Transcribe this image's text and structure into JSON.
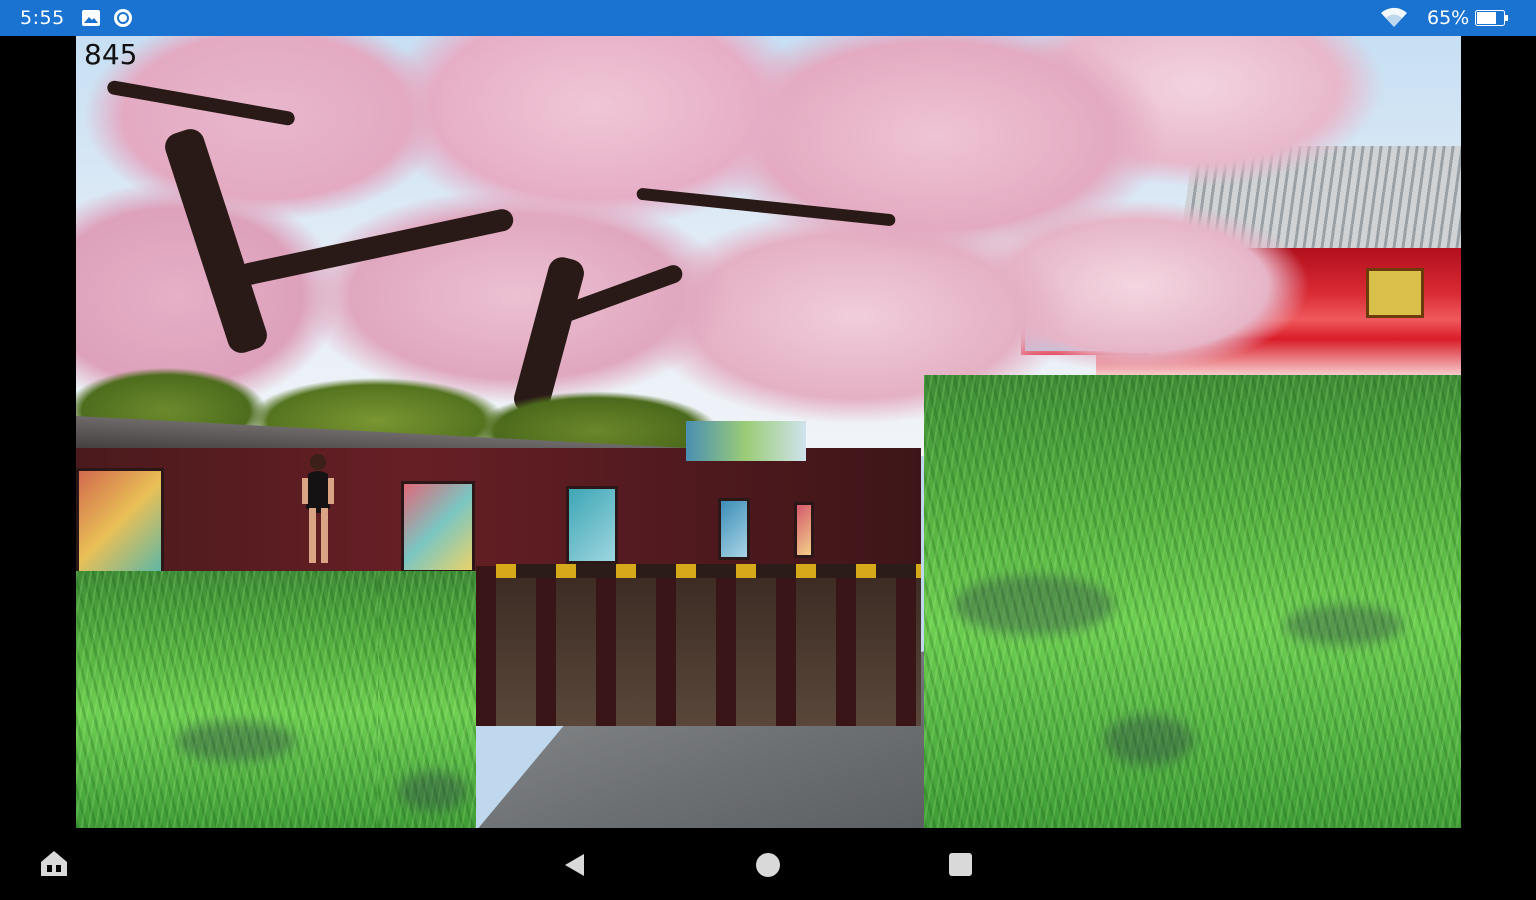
{
  "status_bar": {
    "time": "5:55",
    "battery_percent": "65%",
    "background_color": "#1a73d1",
    "icons": [
      "image-icon",
      "sync-icon",
      "wifi-icon",
      "battery-icon"
    ]
  },
  "game": {
    "score": "845"
  },
  "nav_bar": {
    "icons": [
      "home-app-icon",
      "back-icon",
      "home-icon",
      "recents-icon"
    ]
  }
}
